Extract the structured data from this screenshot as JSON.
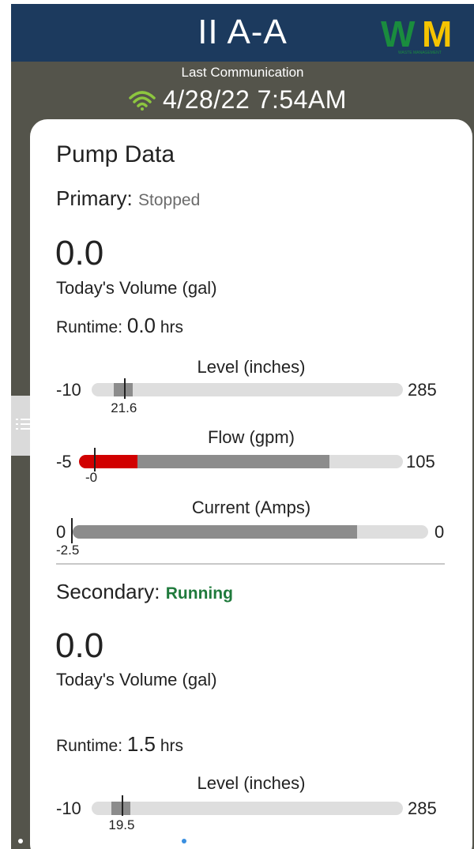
{
  "header": {
    "site_title": "II A-A",
    "logo_text": "WM",
    "logo_subtext": "WASTE MANAGEMENT",
    "last_comm_label": "Last Communication",
    "last_comm_time": "4/28/22 7:54AM"
  },
  "card": {
    "title": "Pump Data",
    "primary": {
      "label": "Primary:",
      "status": "Stopped",
      "volume_value": "0.0",
      "volume_label": "Today's Volume (gal)",
      "runtime_label": "Runtime:",
      "runtime_value": "0.0",
      "runtime_unit": "hrs",
      "level": {
        "title": "Level (inches)",
        "min": "-10",
        "max": "285",
        "value": "21.6",
        "min_num": -10,
        "max_num": 285,
        "value_num": 21.6
      },
      "flow": {
        "title": "Flow (gpm)",
        "min": "-5",
        "max": "105",
        "value": "-0",
        "min_num": -5,
        "max_num": 105,
        "value_num": 0
      },
      "current": {
        "title": "Current (Amps)",
        "min": "0",
        "max": "0",
        "value": "-2.5"
      }
    },
    "secondary": {
      "label": "Secondary:",
      "status": "Running",
      "volume_value": "0.0",
      "volume_label": "Today's Volume (gal)",
      "runtime_label": "Runtime:",
      "runtime_value": "1.5",
      "runtime_unit": "hrs",
      "level": {
        "title": "Level (inches)",
        "min": "-10",
        "max": "285",
        "value": "19.5",
        "min_num": -10,
        "max_num": 285,
        "value_num": 19.5
      }
    }
  },
  "pager": {
    "total": 20,
    "active_index": 7
  },
  "colors": {
    "header_bg": "#1c3a5e",
    "frame_bg": "#54544b",
    "wifi": "#8dc63f",
    "logo_green": "#1a8c3e",
    "logo_yellow": "#f5c400",
    "running": "#1f7a3c",
    "alarm_red": "#d10000",
    "active_dot": "#3a8fe0"
  }
}
